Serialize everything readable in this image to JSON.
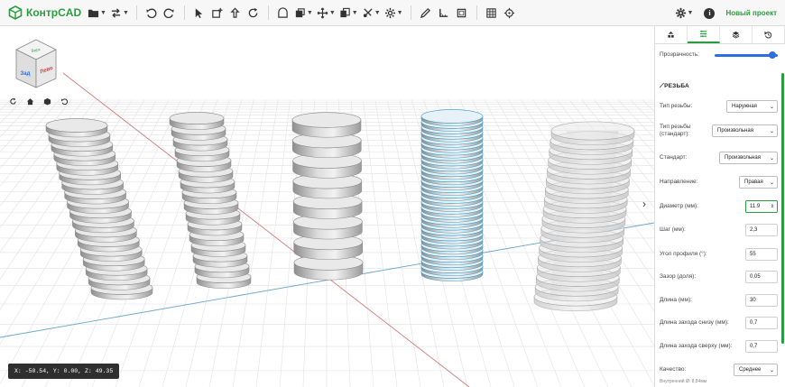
{
  "app": {
    "logo_text": "КонтрCAD",
    "project_name": "Новый проект",
    "brand_color": "#2a9d3f",
    "accent_color": "#2b6fe0"
  },
  "toolbar": {
    "groups": [
      [
        "folder-icon",
        "swap-arrows-icon"
      ],
      [
        "undo-icon",
        "redo-icon"
      ],
      [
        "pointer-icon",
        "add-sketch-icon",
        "upload-icon",
        "refresh-icon"
      ],
      [
        "shape-icon",
        "solid-icon",
        "move-icon",
        "copy-icon",
        "modifier-icon",
        "settings-icon"
      ],
      [
        "pencil-icon",
        "measure-icon",
        "frame-icon"
      ],
      [
        "grid-icon",
        "target-icon"
      ]
    ],
    "right": [
      "gear-icon",
      "info-icon"
    ]
  },
  "viewcube": {
    "top_label": "Верх",
    "left_label": "Зад",
    "right_label": "Лево"
  },
  "coords": {
    "text": "X: -50.54, Y: 0.00, Z: 49.35"
  },
  "panel": {
    "tabs": [
      "objects-icon",
      "properties-icon",
      "layers-icon",
      "history-icon"
    ],
    "active_tab": 1,
    "transparency_label": "Прозрачность:",
    "transparency_value": 0.95,
    "section_title": "РЕЗЬБА",
    "fields": {
      "thread_type_label": "Тип резьбы:",
      "thread_type_value": "Наружная",
      "thread_std_type_label": "Тип резьбы (стандарт):",
      "thread_std_type_value": "Произвольная",
      "standard_label": "Стандарт:",
      "standard_value": "Произвольная",
      "direction_label": "Направление:",
      "direction_value": "Правая",
      "diameter_label": "Диаметр (мм):",
      "diameter_value": "11.9",
      "pitch_label": "Шаг (мм):",
      "pitch_value": "2,3",
      "profile_angle_label": "Угол профиля (°):",
      "profile_angle_value": "55",
      "clearance_label": "Зазор (доля):",
      "clearance_value": "0,05",
      "length_label": "Длина (мм):",
      "length_value": "30",
      "lead_bottom_label": "Длина захода снизу (мм):",
      "lead_bottom_value": "0,7",
      "lead_top_label": "Длина захода сверху (мм):",
      "lead_top_value": "0,7",
      "quality_label": "Качество:",
      "quality_value": "Среднее",
      "inner_diam_hint": "Внутренний Ø: 8,84мм"
    }
  }
}
